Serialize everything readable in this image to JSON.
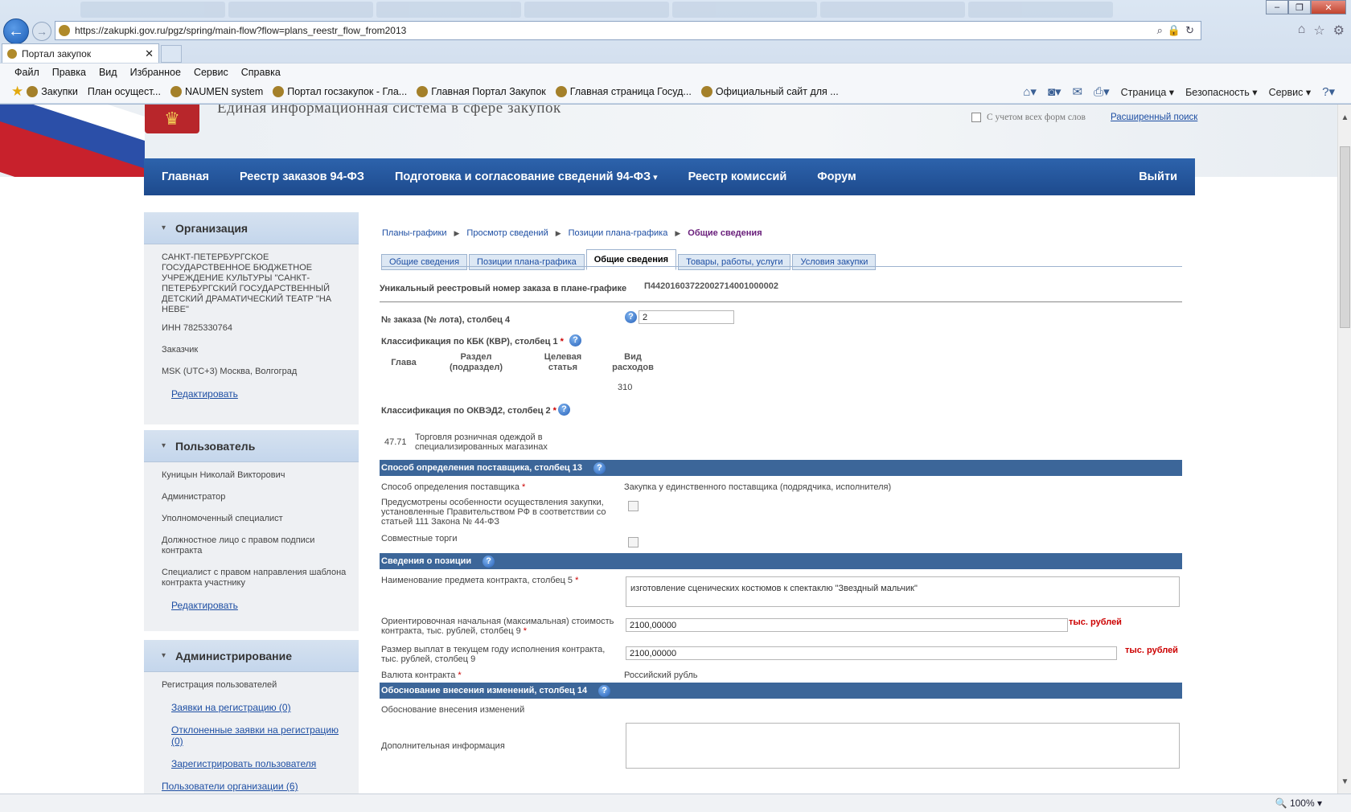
{
  "browser": {
    "url": "https://zakupki.gov.ru/pgz/spring/main-flow?flow=plans_reestr_flow_from2013",
    "tab_title": "Портал закупок",
    "tab_close": "✕",
    "menu": [
      "Файл",
      "Правка",
      "Вид",
      "Избранное",
      "Сервис",
      "Справка"
    ],
    "favorites": [
      "Закупки",
      "План осущест...",
      "NAUMEN system",
      "Портал госзакупок - Гла...",
      "Главная Портал Закупок",
      "Главная страница Госуд...",
      "Официальный сайт для ..."
    ],
    "commands": {
      "page": "Страница",
      "security": "Безопасность",
      "service": "Сервис"
    },
    "zoom": "100%"
  },
  "header": {
    "site_title": "Единая информационная система в сфере закупок",
    "search_all_forms": "С учетом всех форм слов",
    "advanced_search": "Расширенный поиск"
  },
  "nav": {
    "items": [
      "Главная",
      "Реестр заказов 94-ФЗ",
      "Подготовка и согласование сведений 94-ФЗ",
      "Реестр комиссий",
      "Форум"
    ],
    "logout": "Выйти"
  },
  "sidebar": {
    "org": {
      "title": "Организация",
      "name": "САНКТ-ПЕТЕРБУРГСКОЕ ГОСУДАРСТВЕННОЕ БЮДЖЕТНОЕ УЧРЕЖДЕНИЕ КУЛЬТУРЫ \"САНКТ-ПЕТЕРБУРГСКИЙ ГОСУДАРСТВЕННЫЙ ДЕТСКИЙ ДРАМАТИЧЕСКИЙ ТЕАТР \"НА НЕВЕ\"",
      "inn": "ИНН 7825330764",
      "role": "Заказчик",
      "tz": "MSK (UTC+3) Москва, Волгоград",
      "edit": "Редактировать"
    },
    "user": {
      "title": "Пользователь",
      "name": "Куницын Николай Викторович",
      "roles": [
        "Администратор",
        "Уполномоченный специалист",
        "Должностное лицо с правом подписи контракта",
        "Специалист с правом направления шаблона контракта участнику"
      ],
      "edit": "Редактировать"
    },
    "admin": {
      "title": "Администрирование",
      "reg_label": "Регистрация пользователей",
      "links": [
        "Заявки на регистрацию (0)",
        "Отклоненные заявки на регистрацию (0)",
        "Зарегистрировать пользователя"
      ],
      "org_users": "Пользователи организации (6)"
    }
  },
  "breadcrumbs": [
    "Планы-графики",
    "Просмотр сведений",
    "Позиции плана-графика",
    "Общие сведения"
  ],
  "tabs": [
    "Общие сведения",
    "Позиции плана-графика",
    "Общие сведения",
    "Товары, работы, услуги",
    "Условия закупки"
  ],
  "active_tab_index": 2,
  "form": {
    "reg_number_label": "Уникальный реестровый номер заказа в плане-графике",
    "reg_number": "П44201603722002714001000002",
    "lot_label": "№ заказа (№ лота), столбец 4",
    "lot_value": "2",
    "kbk_label": "Классификация по КБК (КВР), столбец 1",
    "kbk_cols": [
      "Глава",
      "Раздел (подраздел)",
      "Целевая статья",
      "Вид расходов"
    ],
    "kbk_vid": "310",
    "okved_label": "Классификация по ОКВЭД2, столбец 2",
    "okved_code": "47.71",
    "okved_name": "Торговля розничная одеждой в специализированных магазинах",
    "sec_supplier": "Способ определения поставщика, столбец 13",
    "supplier_method_label": "Способ определения поставщика",
    "supplier_method": "Закупка у единственного поставщика (подрядчика, исполнителя)",
    "special_label": "Предусмотрены особенности осуществления закупки, установленные Правительством РФ в соответствии  со статьей 111 Закона № 44-ФЗ",
    "joint_label": "Совместные торги",
    "sec_position": "Сведения о позиции",
    "subject_label": "Наименование предмета контракта, столбец 5",
    "subject_value": "изготовление сценических костюмов к спектаклю \"Звездный мальчик\"",
    "price_label": "Ориентировочная начальная (максимальная) стоимость контракта, тыс. рублей, столбец 9",
    "price_value": "2100,00000",
    "price_unit": "тыс. рублей",
    "pay_label": "Размер выплат в текущем году исполнения контракта, тыс. рублей, столбец 9",
    "pay_value": "2100,00000",
    "pay_unit": "тыс. рублей",
    "currency_label": "Валюта контракта",
    "currency_value": "Российский рубль",
    "sec_changes": "Обоснование внесения изменений, столбец 14",
    "changes_label": "Обоснование внесения изменений",
    "extra_label": "Дополнительная информация",
    "req_mark": "*"
  }
}
